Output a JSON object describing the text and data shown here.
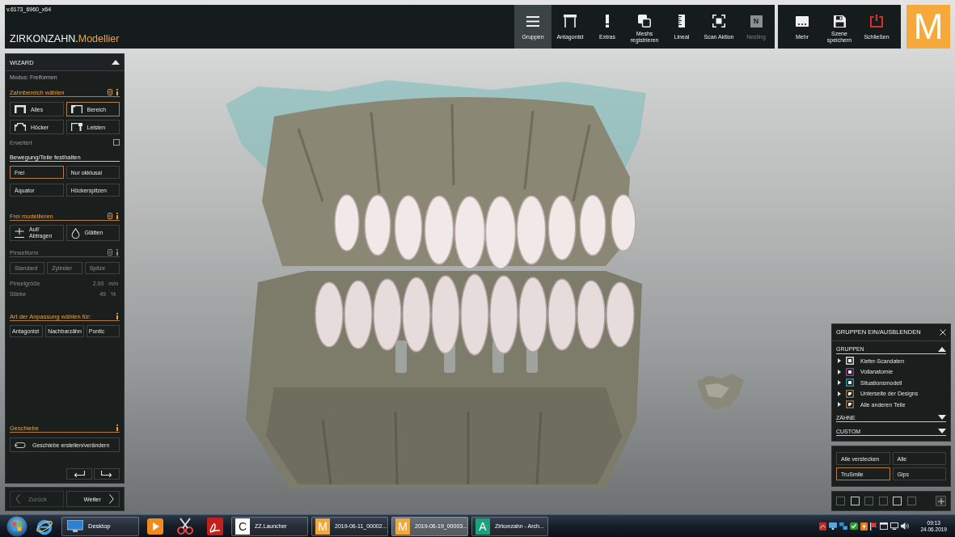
{
  "app": {
    "version": "v.6173_6960_x64",
    "brand": "ZIRKONZAHN.",
    "product": "Modellier",
    "logo_letter": "M"
  },
  "toolbar": [
    {
      "label": "Gruppen",
      "selected": true,
      "disabled": false
    },
    {
      "label": "Antagonist",
      "selected": false,
      "disabled": false
    },
    {
      "label": "Extras",
      "selected": false,
      "disabled": false
    },
    {
      "label": "Meshs registrieren",
      "selected": false,
      "disabled": false
    },
    {
      "label": "Lineal",
      "selected": false,
      "disabled": false
    },
    {
      "label": "Scan Aktion",
      "selected": false,
      "disabled": false
    },
    {
      "label": "Nesting",
      "selected": false,
      "disabled": true,
      "badge": "N"
    }
  ],
  "scene_actions": [
    {
      "label": "Mehr"
    },
    {
      "label": "Szene speichern"
    },
    {
      "label": "Schließen"
    }
  ],
  "wizard": {
    "title": "WIZARD",
    "expanded": true,
    "mode": "Modus: Freiformen",
    "tooth_area": {
      "title": "Zahnbereich wählen",
      "tools": [
        {
          "label": "Alles",
          "selected": false
        },
        {
          "label": "Bereich",
          "selected": true
        },
        {
          "label": "Höcker",
          "selected": false
        },
        {
          "label": "Leisten",
          "selected": false
        }
      ],
      "advanced": {
        "label": "Erweitert",
        "checked": false
      }
    },
    "movement": {
      "title": "Bewegung/Teile festhalten",
      "options": [
        {
          "label": "Frei",
          "selected": true
        },
        {
          "label": "Nur okklusal",
          "selected": false
        },
        {
          "label": "Äquator",
          "selected": false
        },
        {
          "label": "Höckerspitzen",
          "selected": false
        }
      ]
    },
    "free_modelling": {
      "title": "Frei modellieren",
      "tools": [
        {
          "label": "Auf/\nAbtragen",
          "selected": false
        },
        {
          "label": "Glätten",
          "selected": false
        }
      ]
    },
    "brush": {
      "title": "Pinselform",
      "disabled": true,
      "shapes": [
        {
          "label": "Standard",
          "selected": false
        },
        {
          "label": "Zylinder",
          "selected": false
        },
        {
          "label": "Spitze",
          "selected": false
        }
      ],
      "size": {
        "label": "Pinselgröße",
        "value": "2.00",
        "unit": "mm"
      },
      "strength": {
        "label": "Stärke",
        "value": "49",
        "unit": "%"
      }
    },
    "adaptation": {
      "title": "Art der Anpassung wählen für:",
      "options": [
        {
          "label": "Antagonist",
          "selected": false
        },
        {
          "label": "Nachbarzähn",
          "selected": false
        },
        {
          "label": "Pontic",
          "selected": false
        }
      ]
    },
    "attachment": {
      "title": "Geschiebe",
      "action": "Geschiebe erstellen/verändern"
    }
  },
  "navigation": {
    "back": {
      "label": "Zurück",
      "disabled": true
    },
    "next": {
      "label": "Weiter",
      "disabled": false
    }
  },
  "groups_panel": {
    "title": "GRUPPEN EIN/AUSBLENDEN",
    "sections": [
      {
        "title": "GRUPPEN",
        "expanded": true,
        "items": [
          {
            "label": "Kiefer-Scandaten",
            "color": "#d2d2d2",
            "kind": "full",
            "expanded": false
          },
          {
            "label": "Vollanatomie",
            "color": "#8e3f8c",
            "kind": "full",
            "expanded": false
          },
          {
            "label": "Situationsmodell",
            "color": "#2f8f8c",
            "kind": "full",
            "expanded": false
          },
          {
            "label": "Unterseite der Designs",
            "color": "#8c6a4c",
            "kind": "partial",
            "expanded": false
          },
          {
            "label": "Alle anderen Teile",
            "color": "#8c6a4c",
            "kind": "partial",
            "expanded": false
          }
        ]
      },
      {
        "title": "ZÄHNE",
        "expanded": false
      },
      {
        "title": "CUSTOM",
        "expanded": false
      }
    ],
    "filters": [
      {
        "label": "Alle verstecken",
        "selected": false
      },
      {
        "label": "Alle",
        "selected": false
      },
      {
        "label": "TruSmile",
        "selected": true
      },
      {
        "label": "Gips",
        "selected": false
      }
    ],
    "slots": [
      {
        "selected": false
      },
      {
        "selected": true
      },
      {
        "selected": false
      },
      {
        "selected": false
      },
      {
        "selected": true
      },
      {
        "selected": false
      }
    ]
  },
  "taskbar": {
    "desktop_button": "Desktop",
    "windows": [
      {
        "label": "ZZ.Launcher",
        "letter": "C",
        "color": "#ffffff",
        "selected": false
      },
      {
        "label": "2019-06-11_00002...",
        "letter": "M",
        "color": "#f0a838",
        "selected": false
      },
      {
        "label": "2019-06-19_00003...",
        "letter": "M",
        "color": "#f0a838",
        "selected": true
      },
      {
        "label": "Zirkonzahn - Arch...",
        "letter": "A",
        "color": "#1aa37a",
        "selected": false
      }
    ],
    "clock": {
      "time": "09:13",
      "date": "24.06.2019"
    }
  }
}
